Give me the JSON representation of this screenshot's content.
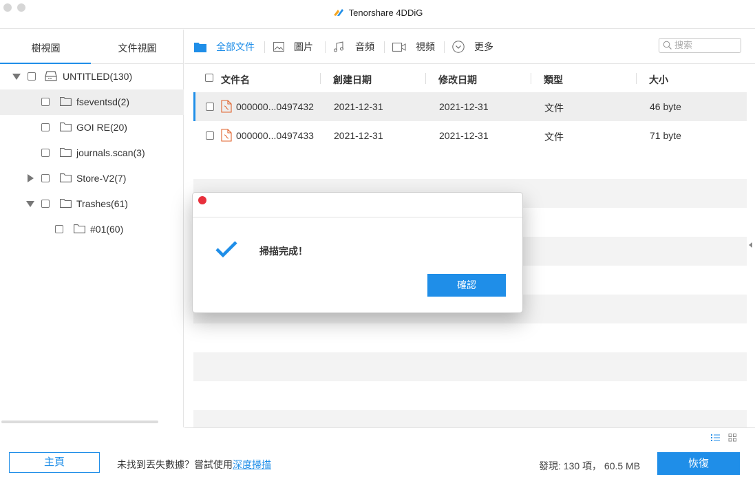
{
  "app": {
    "title": "Tenorshare 4DDiG"
  },
  "left_tabs": [
    {
      "label": "樹視圖"
    },
    {
      "label": "文件視圖"
    }
  ],
  "tree": {
    "root": "UNTITLED(130)",
    "items": [
      {
        "label": "fseventsd(2)"
      },
      {
        "label": "GOI RE(20)"
      },
      {
        "label": "journals.scan(3)"
      },
      {
        "label": "Store-V2(7)"
      },
      {
        "label": "Trashes(61)"
      },
      {
        "label": "#01(60)"
      }
    ]
  },
  "toolbar": {
    "all_files": "全部文件",
    "images": "圖片",
    "audio": "音頻",
    "video": "視頻",
    "more": "更多",
    "search_placeholder": "搜索"
  },
  "columns": {
    "name": "文件名",
    "created": "創建日期",
    "modified": "修改日期",
    "type": "類型",
    "size": "大小"
  },
  "files": [
    {
      "name": "000000...0497432",
      "created": "2021-12-31",
      "modified": "2021-12-31",
      "type": "文件",
      "size": "46 byte"
    },
    {
      "name": "000000...0497433",
      "created": "2021-12-31",
      "modified": "2021-12-31",
      "type": "文件",
      "size": "71 byte"
    }
  ],
  "footer": {
    "home_button": "主頁",
    "hint_text": "未找到丟失數據？嘗試使用",
    "hint_link": "深度掃描",
    "found_text": "發現: 130 項， 60.5 MB",
    "recover_button": "恢復"
  },
  "dialog": {
    "message": "掃描完成！",
    "ok_button": "確認"
  },
  "colors": {
    "accent": "#1f8ee8",
    "close": "#e8303c",
    "file_icon": "#e0602a"
  }
}
